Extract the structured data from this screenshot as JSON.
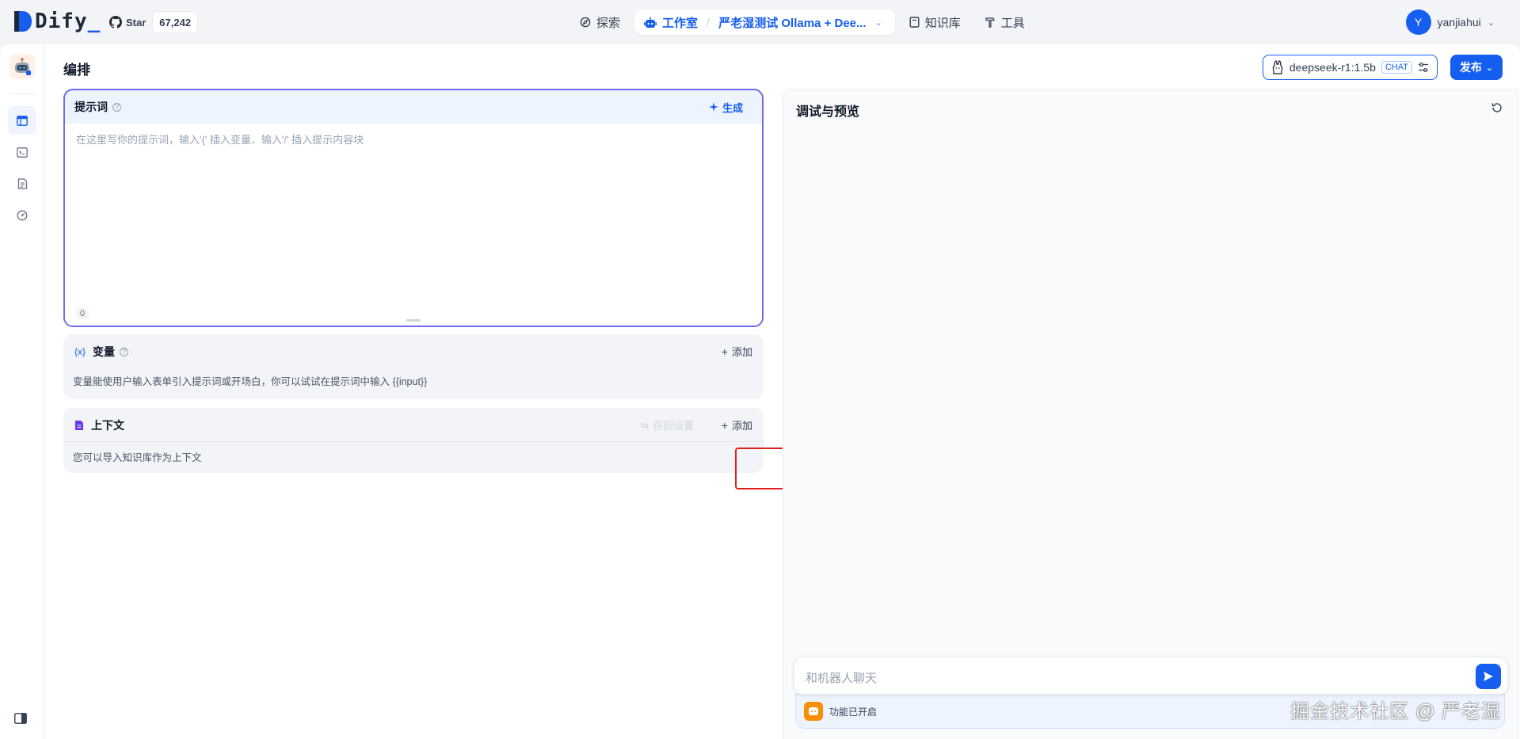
{
  "brand": {
    "logo_text": "Dify",
    "logo_underscore": "_"
  },
  "github": {
    "star_label": "Star",
    "star_count": "67,242"
  },
  "nav": {
    "explore": "探索",
    "studio": "工作室",
    "app_name": "严老湿测试 Ollama + Dee...",
    "knowledge": "知识库",
    "tools": "工具"
  },
  "user": {
    "initial": "Y",
    "name": "yanjiahui"
  },
  "page": {
    "title": "编排"
  },
  "model": {
    "name": "deepseek-r1:1.5b",
    "mode": "CHAT"
  },
  "publish": {
    "label": "发布"
  },
  "prompt": {
    "title": "提示词",
    "generate_label": "生成",
    "placeholder": "在这里写你的提示词，输入'{' 插入变量、输入'/' 插入提示内容块",
    "char_count": "0"
  },
  "variables": {
    "title": "变量",
    "add_label": "添加",
    "description": "变量能使用户输入表单引入提示词或开场白，你可以试试在提示词中输入 {{input}}"
  },
  "context": {
    "title": "上下文",
    "recall_label": "召回设置",
    "add_label": "添加",
    "description": "您可以导入知识库作为上下文"
  },
  "debug": {
    "title": "调试与预览",
    "chat_placeholder": "和机器人聊天",
    "feature_status": "功能已开启"
  },
  "watermark": "掘金技术社区 @ 严老湿",
  "colors": {
    "accent": "#155eef",
    "highlight": "#e02020",
    "prompt_border": "#6f6af2"
  }
}
